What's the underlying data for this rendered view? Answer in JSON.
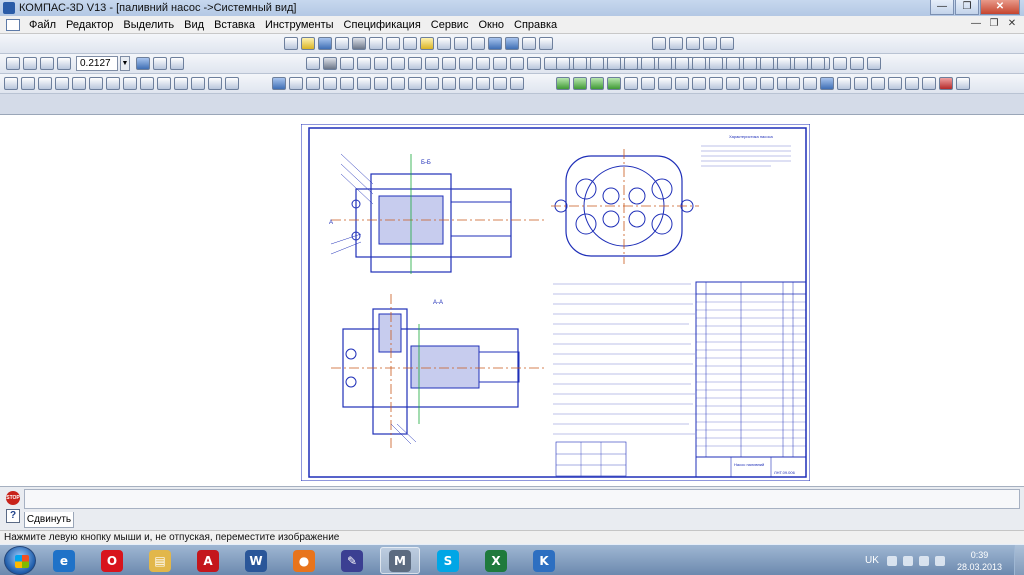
{
  "window": {
    "title": "КОМПАС-3D V13 - [паливний насос ->Системный вид]",
    "min_label": "—",
    "max_label": "❐",
    "close_label": "✕"
  },
  "menu": {
    "items": [
      "Файл",
      "Редактор",
      "Выделить",
      "Вид",
      "Вставка",
      "Инструменты",
      "Спецификация",
      "Сервис",
      "Окно",
      "Справка"
    ],
    "doc_min": "—",
    "doc_max": "❐",
    "doc_close": "✕"
  },
  "toolbar": {
    "zoom_value": "0.2127",
    "dropdown_glyph": "▼"
  },
  "drawing": {
    "section_bb": "Б-Б",
    "section_aa": "А-А",
    "view_label_a": "А",
    "title_block_name": "Насос паливний",
    "title_block_code": "ЛНТ.09.006",
    "characteristics_title": "Характеристика насоса"
  },
  "command_panel": {
    "stop_label": "STOP",
    "help_label": "?",
    "tab_label": "Сдвинуть"
  },
  "status": {
    "hint": "Нажмите левую кнопку мыши и, не отпуская, переместите изображение"
  },
  "taskbar": {
    "apps": [
      {
        "name": "ie",
        "glyph": "e",
        "color": "#1f72c8"
      },
      {
        "name": "opera",
        "glyph": "O",
        "color": "#d8141c"
      },
      {
        "name": "explorer",
        "glyph": "▤",
        "color": "#e2b74a"
      },
      {
        "name": "acrobat",
        "glyph": "A",
        "color": "#c4161c"
      },
      {
        "name": "word",
        "glyph": "W",
        "color": "#2a5699"
      },
      {
        "name": "firefox",
        "glyph": "●",
        "color": "#e8741c"
      },
      {
        "name": "kompas-pen",
        "glyph": "✎",
        "color": "#3b3f92"
      },
      {
        "name": "kompas",
        "glyph": "M",
        "color": "#5c6b80"
      },
      {
        "name": "skype",
        "glyph": "S",
        "color": "#00a6e6"
      },
      {
        "name": "excel",
        "glyph": "X",
        "color": "#1f7a3c"
      },
      {
        "name": "kompas-viewer",
        "glyph": "K",
        "color": "#2d6fc1"
      }
    ],
    "lang": "UK",
    "time": "0:39",
    "date": "28.03.2013"
  }
}
